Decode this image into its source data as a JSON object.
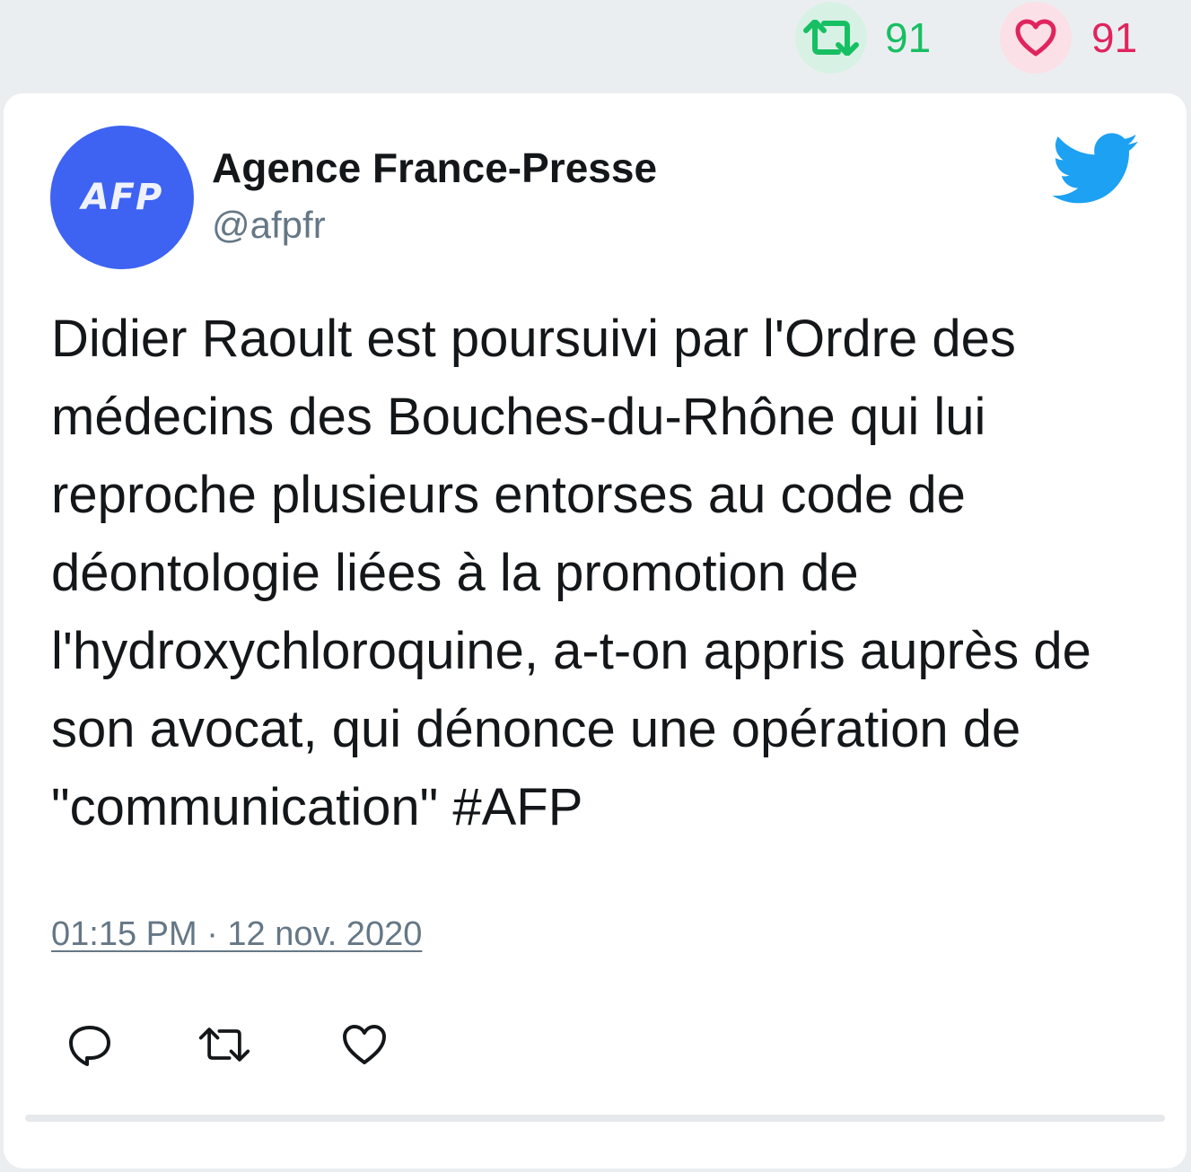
{
  "stats": {
    "retweet_icon": "retweet-icon",
    "retweet_count": "91",
    "retweet_color": "#17bf63",
    "like_icon": "heart-icon",
    "like_count": "91",
    "like_color": "#e0245e"
  },
  "tweet": {
    "avatar_label": "AFP",
    "avatar_color": "#3e63f2",
    "author_name": "Agence France-Presse",
    "author_handle": "@afpfr",
    "brand_icon": "twitter-bird-icon",
    "brand_color": "#1da1f2",
    "text": "Didier Raoult est poursuivi par l'Ordre des médecins des Bouches-du-Rhône qui lui reproche plusieurs entorses au code de déontologie liées à la promotion de l'hydroxychloroquine, a-t-on appris auprès de son avocat, qui dénonce une opération de \"communication\" #AFP",
    "timestamp": "01:15 PM · 12 nov. 2020"
  },
  "actions": {
    "reply_icon": "reply-icon",
    "retweet_icon": "retweet-icon",
    "like_icon": "heart-icon"
  }
}
